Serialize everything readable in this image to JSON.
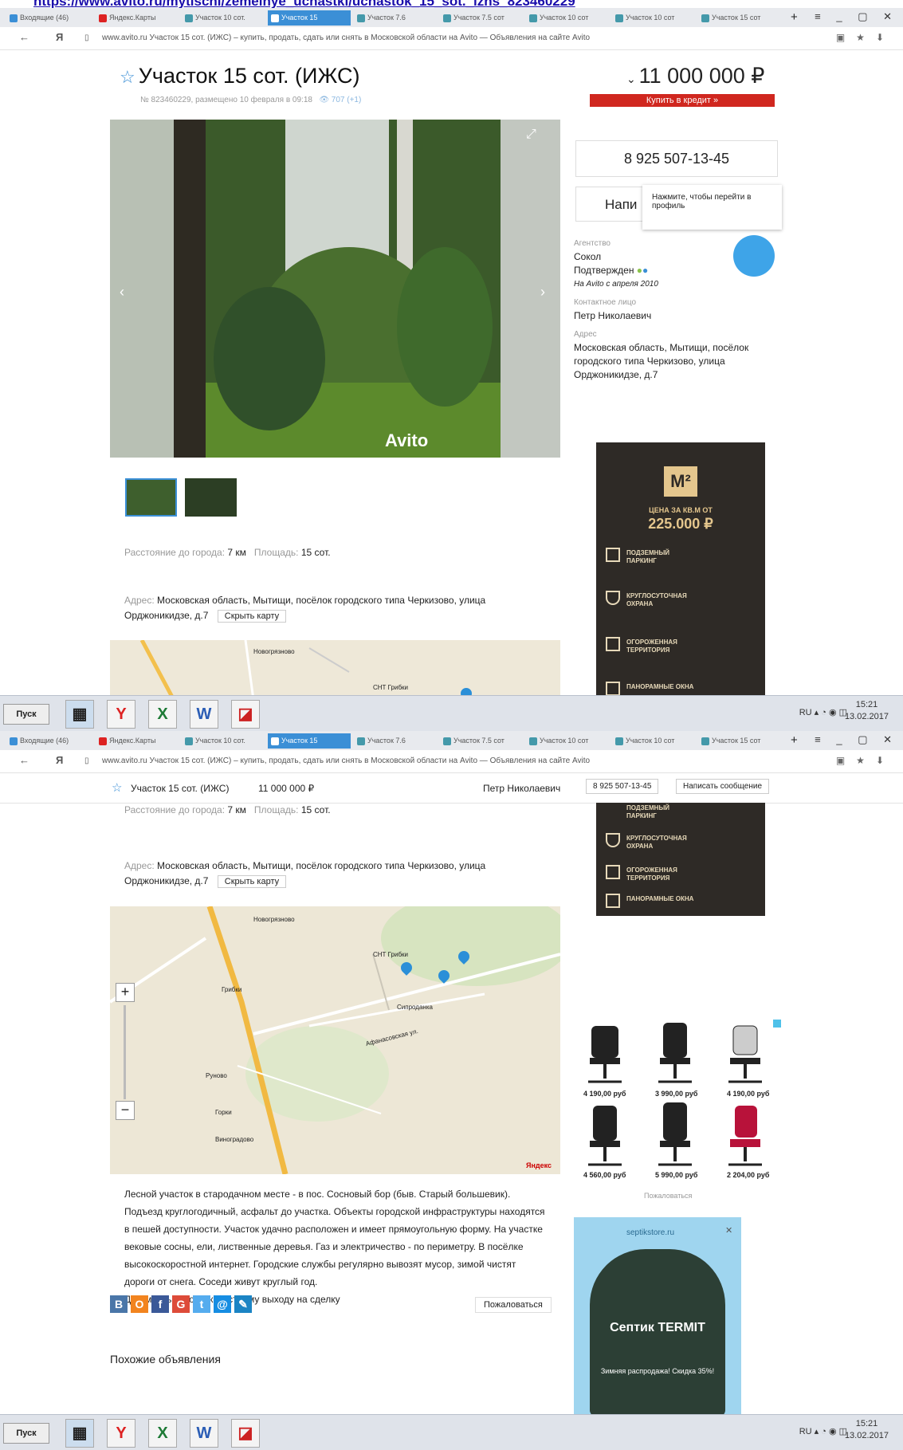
{
  "top_link": "https://www.avito.ru/mytischi/zemelnye_uchastki/uchastok_15_sot._izhs_823460229",
  "browser": {
    "tabs": [
      "Входящие (46)",
      "Яндекс.Карты",
      "Участок 10 сот.",
      "Участок 15",
      "Участок 7.6",
      "Участок 7.5 сот",
      "Участок 10 сот",
      "Участок 10 сот",
      "Участок 15 сот"
    ],
    "url": "www.avito.ru   Участок 15 сот. (ИЖС) – купить, продать, сдать или снять в Московской области на Avito — Объявления на сайте Avito"
  },
  "listing": {
    "title": "Участок 15 сот. (ИЖС)",
    "meta": "№ 823460229, размещено 10 февраля в 09:18",
    "views": "707 (+1)",
    "price": "11 000 000 ₽",
    "credit_button": "Купить в кредит »",
    "phone": "8 925 507-13-45",
    "write_button": "Напи",
    "tooltip": "Нажмите, чтобы перейти в профиль",
    "agency_label": "Агентство",
    "agency_name": "Сокол",
    "verified": "Подтвержден",
    "on_avito_since": "На Avito с апреля 2010",
    "contact_label": "Контактное лицо",
    "contact_name": "Петр Николаевич",
    "address_label": "Адрес",
    "address_side": "Московская область, Мытищи, посёлок городского типа Черкизово, улица Орджоникидзе, д.7",
    "params_distance_label": "Расстояние до города:",
    "params_distance_value": "7 км",
    "params_area_label": "Площадь:",
    "params_area_value": "15 сот.",
    "address_main_label": "Адрес:",
    "address_main_value": "Московская область, Мытищи, посёлок городского типа Черкизово, улица Орджоникидзе, д.7",
    "hide_map": "Скрыть карту",
    "photo_watermark": "Avito",
    "description": "Лесной участок в стародачном месте - в пос. Сосновый бор (быв. Старый большевик). Подъезд круглогодичный, асфальт до участка. Объекты городской инфраструктуры находятся в пешей доступности. Участок удачно расположен и имеет прямоугольную форму. На участке вековые сосны, ели, лиственные деревья. Газ и электричество - по периметру. В посёлке высокоскоростной интернет. Городские службы регулярно вывозят мусор, зимой чистят дороги от снега. Соседи живут круглый год.",
    "documents": "Документы готовы к быстрому выходу на сделку",
    "complain": "Пожаловаться",
    "similar": "Похожие объявления"
  },
  "sticky": {
    "title": "Участок 15 сот. (ИЖС)",
    "price": "11 000 000 ₽",
    "contact": "Петр Николаевич",
    "phone": "8 925 507-13-45",
    "write": "Написать сообщение"
  },
  "map_labels": [
    "Новогрязново",
    "СНТ Грибки",
    "Грибки",
    "Сипроданка",
    "Афанасовская ул.",
    "Руново",
    "Горки",
    "Виноградово",
    "Яндекс"
  ],
  "ad1": {
    "logo": "М²",
    "price_caption": "ЦЕНА ЗА КВ.М ОТ",
    "price": "225.000 ₽",
    "features": [
      "ПОДЗЕМНЫЙ ПАРКИНГ",
      "КРУГЛОСУТОЧНАЯ ОХРАНА",
      "ОГОРОЖЕННАЯ ТЕРРИТОРИЯ",
      "ПАНОРАМНЫЕ ОКНА"
    ]
  },
  "ad_chairs": {
    "prices": [
      "4 190,00 руб",
      "3 990,00 руб",
      "4 190,00 руб",
      "4 560,00 руб",
      "5 990,00 руб",
      "2 204,00 руб"
    ],
    "complain": "Пожаловаться"
  },
  "ad2": {
    "domain": "septikstore.ru",
    "title": "Септик TERMIT",
    "subtitle": "Зимняя распродажа! Скидка 35%!"
  },
  "taskbar": {
    "start": "Пуск",
    "lang": "RU",
    "time": "15:21",
    "date": "13.02.2017"
  },
  "colors": {
    "accent": "#3b8fd6",
    "price_red": "#d0271f",
    "ad_dark": "#2e2a26"
  }
}
